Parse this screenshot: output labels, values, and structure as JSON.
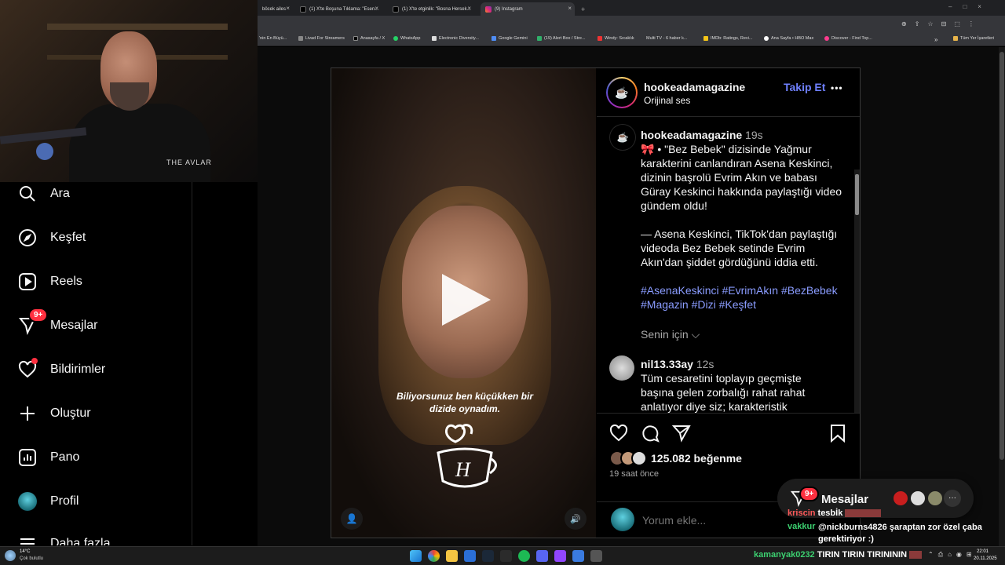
{
  "browser": {
    "tabs": [
      {
        "label": "böcek ailes",
        "active": false
      },
      {
        "label": "(1) X'te Boşuna Tıklama: \"Esen...",
        "active": false
      },
      {
        "label": "(1) X'te etginlik: \"Bosna Hersek...",
        "active": false
      },
      {
        "label": "(9) Instagram",
        "active": true
      }
    ],
    "new_tab": "+",
    "bookmarks": [
      "'nin En Büyü...",
      "Livad For Streamers",
      "Anasayfa / X",
      "WhatsApp",
      "Electronic Diversity...",
      "Google Gemini",
      "(19) Alert Box / Stre...",
      "Windy: Sıcaklık",
      "Multi TV - 6 haber k...",
      "IMDb: Ratings, Revi...",
      "Ana Sayfa • HBO Max",
      "Discover - Find Top..."
    ],
    "bookmarks_more": "»",
    "all_bookmarks": "Tüm Yer İşaretleri"
  },
  "sidebar": {
    "items": [
      {
        "label": "Ara",
        "icon": "search-icon"
      },
      {
        "label": "Keşfet",
        "icon": "compass-icon"
      },
      {
        "label": "Reels",
        "icon": "reels-icon"
      },
      {
        "label": "Mesajlar",
        "icon": "messenger-icon",
        "badge": "9+"
      },
      {
        "label": "Bildirimler",
        "icon": "heart-icon"
      },
      {
        "label": "Oluştur",
        "icon": "plus-icon"
      },
      {
        "label": "Pano",
        "icon": "dashboard-icon"
      },
      {
        "label": "Profil",
        "icon": "avatar"
      },
      {
        "label": "Daha fazla",
        "icon": "menu-icon"
      }
    ]
  },
  "webcam": {
    "logo_text": "THE AVLAR"
  },
  "post": {
    "video": {
      "caption": "Biliyorsunuz ben küçükken bir dizide oynadım.",
      "watermark": "H"
    },
    "header": {
      "username": "hookeadamagazine",
      "audio": "Orijinal ses",
      "follow": "Takip Et",
      "more": "•••"
    },
    "caption": {
      "username": "hookeadamagazine",
      "time": "19s",
      "paragraph1": "🎀 • \"Bez Bebek\" dizisinde Yağmur karakterini canlandıran Asena Keskinci, dizinin başrolü Evrim Akın ve babası Güray Keskinci hakkında paylaştığı video gündem oldu!",
      "paragraph2": "— Asena Keskinci, TikTok'dan paylaştığı videoda Bez Bebek setinde Evrim Akın'dan şiddet gördüğünü iddia etti.",
      "hashtags": "#AsenaKeskinci #EvrimAkın #BezBebek #Magazin #Dizi #Keşfet",
      "translation": "Senin için ⌵"
    },
    "comment": {
      "username": "nil13.33ay",
      "time": "12s",
      "text": "Tüm cesaretini toplayıp geçmişte başına gelen zorbalığı rahat rahat anlatıyor diye siz; karakteristik"
    },
    "likes": "125.082 beğenme",
    "posted": "19 saat önce",
    "add_comment_placeholder": "Yorum ekle..."
  },
  "messages_popup": {
    "label": "Mesajlar",
    "badge": "9+",
    "more": "···"
  },
  "chat_overlay": [
    {
      "user": "kriscin",
      "color": "#ff5a5a",
      "text": "tesbİk"
    },
    {
      "user": "vakkur",
      "color": "#3cd070",
      "text": "@nickburns4826 şaraptan zor özel çaba gerektiriyor :)"
    },
    {
      "user": "kamanyak0232",
      "color": "#3cd070",
      "text": "TIRIN TIRIN TIRINININ"
    }
  ],
  "taskbar": {
    "weather_temp": "14°C",
    "weather_desc": "Çok bulutlu",
    "clock_time": "22:01",
    "clock_date": "20.11.2025"
  }
}
